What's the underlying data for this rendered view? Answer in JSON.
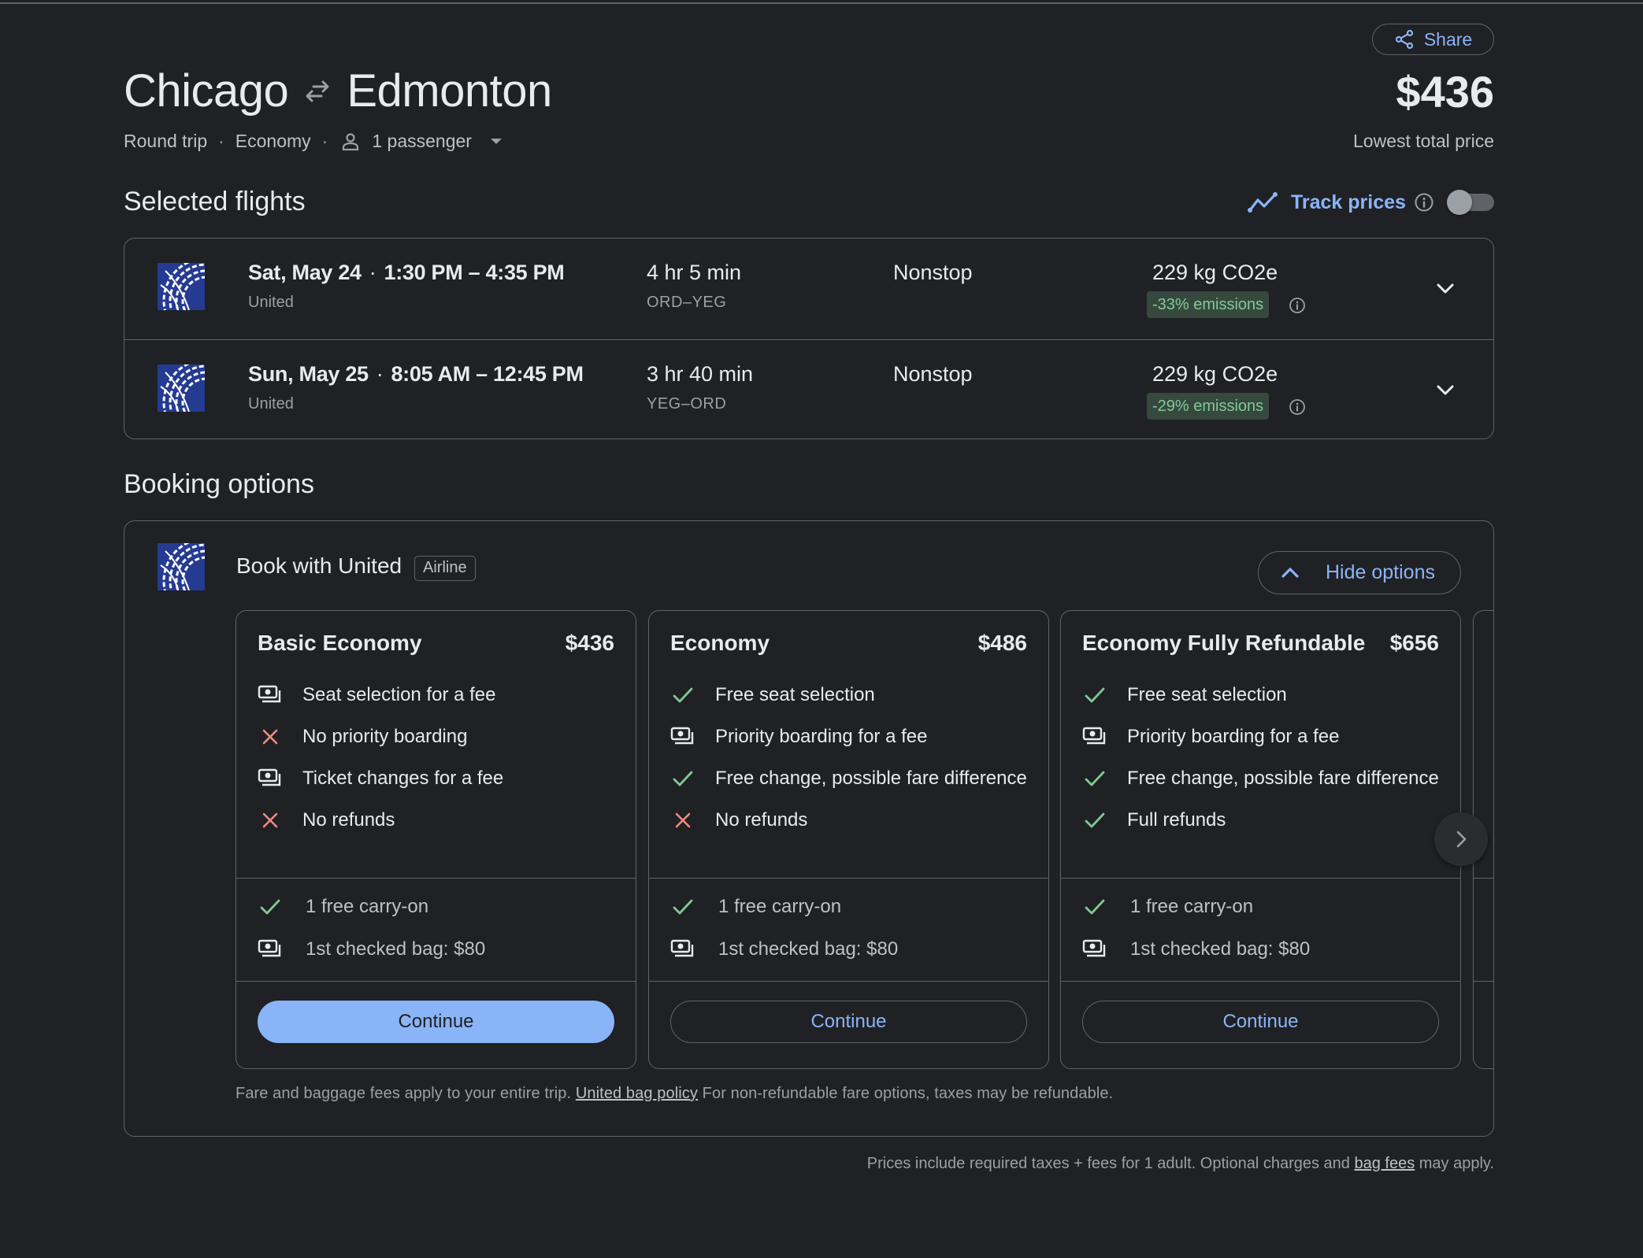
{
  "header": {
    "origin": "Chicago",
    "destination": "Edmonton",
    "swap_icon": "swap-arrows-icon",
    "trip_type": "Round trip",
    "cabin_class": "Economy",
    "passengers": "1 passenger",
    "share_label": "Share",
    "lowest_price": "$436",
    "lowest_price_label": "Lowest total price"
  },
  "selected_flights": {
    "heading": "Selected flights",
    "track_prices_label": "Track prices",
    "track_prices_enabled": false,
    "flights": [
      {
        "date": "Sat, May 24",
        "times": "1:30 PM – 4:35 PM",
        "airline": "United",
        "duration": "4 hr 5 min",
        "route": "ORD–YEG",
        "stops": "Nonstop",
        "emissions": "229 kg CO2e",
        "emissions_delta": "-33% emissions"
      },
      {
        "date": "Sun, May 25",
        "times": "8:05 AM – 12:45 PM",
        "airline": "United",
        "duration": "3 hr 40 min",
        "route": "YEG–ORD",
        "stops": "Nonstop",
        "emissions": "229 kg CO2e",
        "emissions_delta": "-29% emissions"
      }
    ]
  },
  "booking": {
    "heading": "Booking options",
    "provider": "Book with United",
    "provider_tag": "Airline",
    "hide_options_label": "Hide options",
    "fares": [
      {
        "name": "Basic Economy",
        "price": "$436",
        "features": [
          {
            "icon": "fee",
            "text": "Seat selection for a fee"
          },
          {
            "icon": "no",
            "text": "No priority boarding"
          },
          {
            "icon": "fee",
            "text": "Ticket changes for a fee"
          },
          {
            "icon": "no",
            "text": "No refunds"
          }
        ],
        "bags": [
          {
            "icon": "yes",
            "text": "1 free carry-on"
          },
          {
            "icon": "fee",
            "text": "1st checked bag: $80"
          }
        ],
        "continue_label": "Continue",
        "primary": true
      },
      {
        "name": "Economy",
        "price": "$486",
        "features": [
          {
            "icon": "yes",
            "text": "Free seat selection"
          },
          {
            "icon": "fee",
            "text": "Priority boarding for a fee"
          },
          {
            "icon": "yes",
            "text": "Free change, possible fare difference"
          },
          {
            "icon": "no",
            "text": "No refunds"
          }
        ],
        "bags": [
          {
            "icon": "yes",
            "text": "1 free carry-on"
          },
          {
            "icon": "fee",
            "text": "1st checked bag: $80"
          }
        ],
        "continue_label": "Continue",
        "primary": false
      },
      {
        "name": "Economy Fully Refundable",
        "price": "$656",
        "features": [
          {
            "icon": "yes",
            "text": "Free seat selection"
          },
          {
            "icon": "fee",
            "text": "Priority boarding for a fee"
          },
          {
            "icon": "yes",
            "text": "Free change, possible fare difference"
          },
          {
            "icon": "yes",
            "text": "Full refunds"
          }
        ],
        "bags": [
          {
            "icon": "yes",
            "text": "1 free carry-on"
          },
          {
            "icon": "fee",
            "text": "1st checked bag: $80"
          }
        ],
        "continue_label": "Continue",
        "primary": false
      }
    ],
    "fare_note_before": "Fare and baggage fees apply to your entire trip.",
    "fare_note_link": "United bag policy",
    "fare_note_after": "For non-refundable fare options, taxes may be refundable."
  },
  "footer": {
    "note_before": "Prices include required taxes + fees for 1 adult. Optional charges and",
    "note_link": "bag fees",
    "note_after": "may apply."
  },
  "colors": {
    "background": "#202124",
    "accent": "#8ab4f8",
    "positive": "#81c995",
    "negative": "#f28b82",
    "border": "#5f6368",
    "united_blue": "#253b92"
  }
}
